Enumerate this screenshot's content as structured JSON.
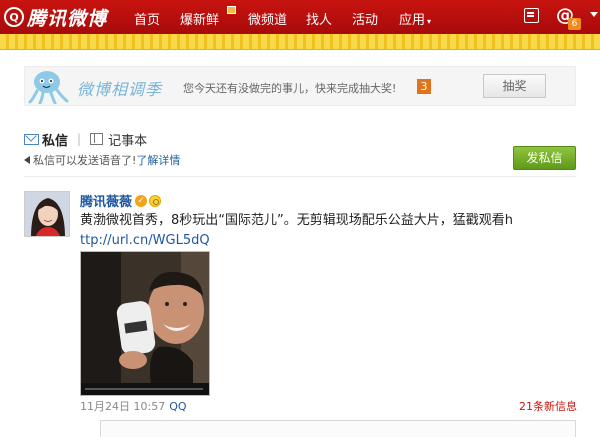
{
  "topbar": {
    "logo_mark": "Q",
    "logo_text": "腾讯微博",
    "nav": [
      {
        "label": "首页"
      },
      {
        "label": "爆新鲜"
      },
      {
        "label": "微频道"
      },
      {
        "label": "找人"
      },
      {
        "label": "活动"
      },
      {
        "label": "应用"
      }
    ],
    "app_caret": "▾",
    "mentions_symbol": "@",
    "mentions_count": "6"
  },
  "banner": {
    "title": "微博相调季",
    "description": "您今天还有没做完的事儿，快来完成抽大奖!",
    "count": "3",
    "draw_label": "抽奖"
  },
  "tabs": {
    "private_messages": "私信",
    "separator": "|",
    "notebook": "记事本"
  },
  "voice_tip": {
    "text": "私信可以发送语音了!",
    "link": "了解详情"
  },
  "send_message_label": "发私信",
  "post": {
    "author": "腾讯薇薇",
    "verify_mark": "✓",
    "text": "黄渤微视首秀，8秒玩出“国际范儿”。无剪辑现场配乐公益大片，猛戳观看h",
    "link_text": "ttp://url.cn/WGL5dQ",
    "timestamp": "11月24日 10:57",
    "source": "QQ",
    "new_messages": "21条新信息"
  },
  "colors": {
    "topbar_red": "#b50f0d",
    "link_blue": "#1e57a3",
    "send_green": "#6aa823",
    "alert_red": "#c8160e",
    "badge_orange": "#e0731c"
  }
}
